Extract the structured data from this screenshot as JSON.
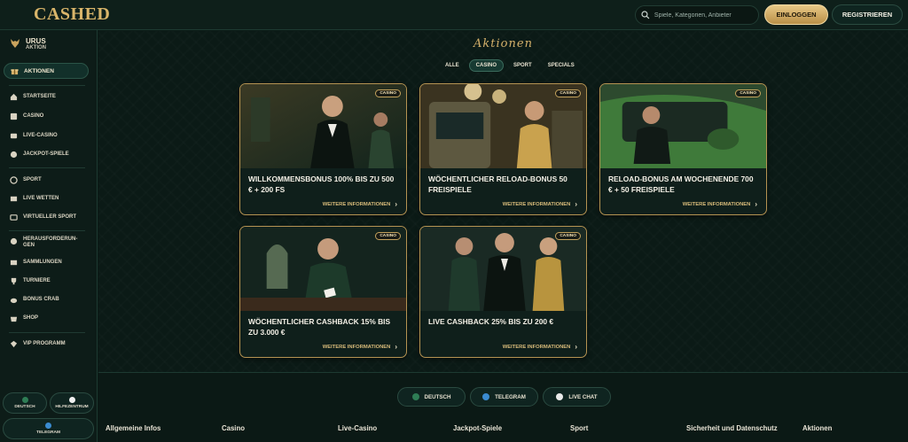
{
  "header": {
    "logo": "CASHED",
    "search_placeholder": "Spiele, Kategorien, Anbieter",
    "login_label": "EINLOGGEN",
    "register_label": "REGISTRIEREN"
  },
  "sidebar": {
    "promo_title": "URUS",
    "promo_subtitle": "AKTION",
    "active_label": "AKTIONEN",
    "items": [
      {
        "label": "STARTSEITE",
        "icon": "home-icon"
      },
      {
        "label": "CASINO",
        "icon": "casino-icon"
      },
      {
        "label": "LIVE-CASINO",
        "icon": "live-casino-icon"
      },
      {
        "label": "JACKPOT-SPIELE",
        "icon": "jackpot-icon"
      },
      {
        "label": "SPORT",
        "icon": "sport-icon"
      },
      {
        "label": "LIVE WETTEN",
        "icon": "live-bet-icon"
      },
      {
        "label": "VIRTUELLER SPORT",
        "icon": "virtual-sport-icon"
      },
      {
        "label": "HERAUSFORDERUN-",
        "label2": "GEN",
        "icon": "challenges-icon"
      },
      {
        "label": "SAMMLUNGEN",
        "icon": "collections-icon"
      },
      {
        "label": "TURNIERE",
        "icon": "trophy-icon"
      },
      {
        "label": "BONUS CRAB",
        "icon": "crab-icon"
      },
      {
        "label": "SHOP",
        "icon": "shop-icon"
      },
      {
        "label": "VIP PROGRAMM",
        "icon": "vip-icon"
      }
    ],
    "bottom": {
      "language": "DEUTSCH",
      "help": "HILFEZENTRUM",
      "telegram": "TELEGRAM"
    }
  },
  "main": {
    "title": "Aktionen",
    "tabs": [
      "ALLE",
      "CASINO",
      "SPORT",
      "SPECIALS"
    ],
    "active_tab": "CASINO",
    "more_label": "WEITERE INFORMATIONEN",
    "cards": [
      {
        "badge": "CASINO",
        "title": "WILLKOMMENSBONUS 100% BIS ZU 500 € + 200 FS"
      },
      {
        "badge": "CASINO",
        "title": "WÖCHENTLICHER RELOAD-BONUS 50 FREISPIELE"
      },
      {
        "badge": "CASINO",
        "title": "RELOAD-BONUS AM WOCHENENDE 700 € + 50 FREISPIELE"
      },
      {
        "badge": "CASINO",
        "title": "WÖCHENTLICHER CASHBACK 15% BIS ZU 3.000 €"
      },
      {
        "badge": "CASINO",
        "title": "LIVE CASHBACK 25% BIS ZU 200 €"
      }
    ]
  },
  "footer": {
    "buttons": [
      "DEUTSCH",
      "TELEGRAM",
      "LIVE CHAT"
    ],
    "columns": [
      "Allgemeine Infos",
      "Casino",
      "Live-Casino",
      "Jackpot-Spiele",
      "Sport",
      "Sicherheit und Datenschutz",
      "Aktionen"
    ]
  },
  "colors": {
    "background": "#0b1a16",
    "gold_accent": "#d4b06a",
    "card_border": "#b59352"
  }
}
